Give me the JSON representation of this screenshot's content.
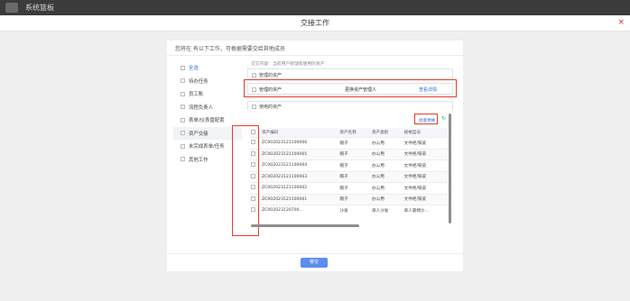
{
  "app": {
    "name": "系统篮板"
  },
  "modal": {
    "title": "交接工作",
    "close": "×"
  },
  "intro": "您将在 有以下工作，可根据需要交给其他成员",
  "nav": [
    {
      "label": "全选",
      "active": false,
      "blue": true
    },
    {
      "label": "待办任务",
      "active": false,
      "blue": false
    },
    {
      "label": "员工账",
      "active": false,
      "blue": false
    },
    {
      "label": "流程负责人",
      "active": false,
      "blue": false
    },
    {
      "label": "表单/仪表盘配置",
      "active": false,
      "blue": false
    },
    {
      "label": "资产交接",
      "active": true,
      "blue": false
    },
    {
      "label": "未完成表单/任务",
      "active": false,
      "blue": false
    },
    {
      "label": "其他工作",
      "active": false,
      "blue": false
    }
  ],
  "content": {
    "tip": "交交内容：当前用户管理和使用的资产",
    "managed_section": "管理的资产",
    "managed_row": {
      "label": "管理的资产",
      "action": "更换资产管理人",
      "link": "查看详情"
    },
    "used_section": "使用的资产",
    "batch_btn": "批量更换",
    "refresh": "↻",
    "columns": [
      "资产编码",
      "资产名称",
      "资产类别",
      "规格型号"
    ],
    "rows": [
      [
        "ZC002023121100066",
        "帽子",
        "办公用",
        "文件柜/铁皮"
      ],
      [
        "ZC002023121100065",
        "帽子",
        "办公用",
        "文件柜/铁皮"
      ],
      [
        "ZC002023121100064",
        "帽子",
        "办公用",
        "文件柜/铁皮"
      ],
      [
        "ZC002023121100063",
        "帽子",
        "办公用",
        "文件柜/铁皮"
      ],
      [
        "ZC002023121100062",
        "帽子",
        "办公用",
        "文件柜/铁皮"
      ],
      [
        "ZC002023121100061",
        "帽子",
        "办公用",
        "文件柜/铁皮"
      ],
      [
        "ZC002023120700…",
        "沙发",
        "单人沙发",
        "单人靠椅沙…"
      ]
    ]
  },
  "footer": {
    "submit": "移交"
  }
}
